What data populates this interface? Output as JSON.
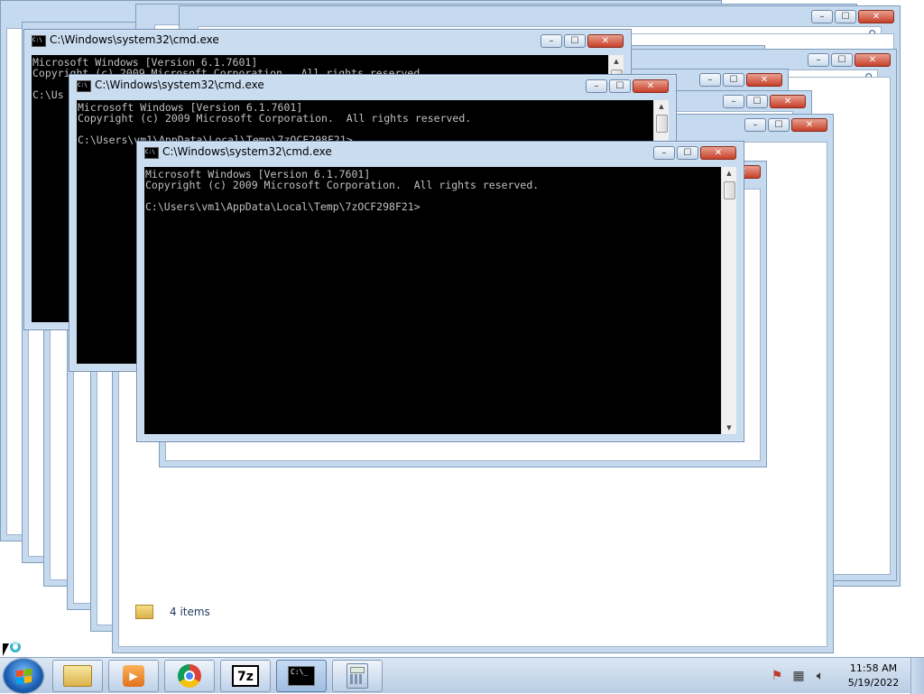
{
  "console_window": {
    "title": "C:\\Windows\\system32\\cmd.exe",
    "line1": "Microsoft Windows [Version 6.1.7601]",
    "line2": "Copyright (c) 2009 Microsoft Corporation.  All rights reserved.",
    "line3": "",
    "prompt": "C:\\Users\\vm1\\AppData\\Local\\Temp\\7zOCF298F21>"
  },
  "console_window_back": {
    "title": "C:\\Windows\\system32\\cmd.exe",
    "line1": "Microsoft Windows [Version 6.1.7601]",
    "line2": "Copyright (c) 2009 Microsoft Corporation.  All rights reserved.",
    "prompt_partial": "C:\\Us"
  },
  "console_window_mid": {
    "title": "C:\\Windows\\system32\\cmd.exe",
    "line1": "Microsoft Windows [Version 6.1.7601]",
    "line2": "Copyright (c) 2009 Microsoft Corporation.  All rights reserved.",
    "prompt_partial": "C:\\Users\\vm1\\AppData\\Local\\Temp\\7zOCF298F21>"
  },
  "window_buttons": {
    "minimize": "–",
    "maximize": "☐",
    "close": "✕"
  },
  "explorer_status": {
    "items_label": "4 items"
  },
  "taskbar": {
    "apps": [
      {
        "name": "windows-explorer"
      },
      {
        "name": "windows-media-player"
      },
      {
        "name": "google-chrome"
      },
      {
        "name": "7-zip",
        "label": "7z"
      },
      {
        "name": "command-prompt",
        "label": "C:\\_"
      },
      {
        "name": "calculator"
      }
    ],
    "clock_time": "11:58 AM",
    "clock_date": "5/19/2022"
  },
  "colors": {
    "console_bg": "#000000",
    "console_fg": "#c0c0c0",
    "titlebar": "#c9dcf0",
    "taskbar": "#c9dae9",
    "close_button": "#c7402a"
  }
}
